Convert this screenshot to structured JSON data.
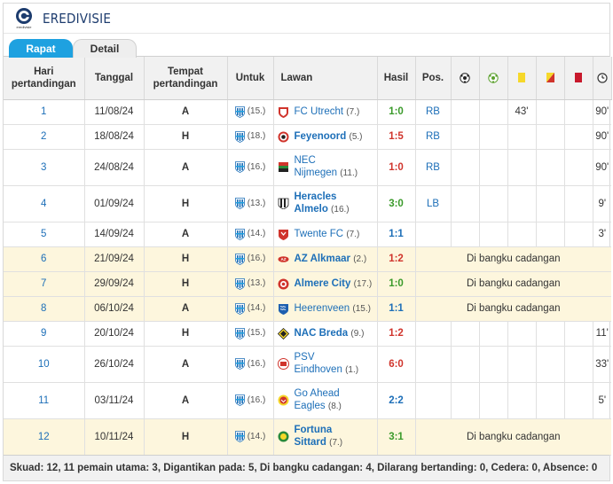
{
  "competition": {
    "name": "EREDIVISIE",
    "logo_text": "eredivisie"
  },
  "tabs": [
    {
      "label": "Rapat"
    },
    {
      "label": "Detail"
    }
  ],
  "headers": {
    "matchday": "Hari pertandingan",
    "date": "Tanggal",
    "venue": "Tempat pertandingan",
    "club": "Untuk",
    "opponent": "Lawan",
    "result": "Hasil",
    "position": "Pos."
  },
  "header_icons": [
    "goals-icon",
    "assists-icon",
    "yellow-card-icon",
    "second-yellow-icon",
    "red-card-icon",
    "minutes-played-icon"
  ],
  "colors": {
    "accent": "#1ea1e0",
    "link": "#1d6fb8",
    "win": "#3a9a2a",
    "loss": "#d0342c",
    "draw": "#1d6fb8",
    "bench_row": "#fdf6dd"
  },
  "rows": [
    {
      "md": "1",
      "date": "11/08/24",
      "venue": "A",
      "club_rank": "(15.)",
      "opponent": "FC Utrecht",
      "opp_rank": "(7.)",
      "opp_bold": false,
      "opp_logo": "fc-utrecht",
      "score": "1:0",
      "outcome": "win",
      "pos": "RB",
      "goals": "",
      "assists": "",
      "yellow": "43'",
      "second_yellow": "",
      "red": "",
      "minutes": "90'",
      "bench": false
    },
    {
      "md": "2",
      "date": "18/08/24",
      "venue": "H",
      "club_rank": "(18.)",
      "opponent": "Feyenoord",
      "opp_rank": "(5.)",
      "opp_bold": true,
      "opp_logo": "feyenoord",
      "score": "1:5",
      "outcome": "loss",
      "pos": "RB",
      "goals": "",
      "assists": "",
      "yellow": "",
      "second_yellow": "",
      "red": "",
      "minutes": "90'",
      "bench": false
    },
    {
      "md": "3",
      "date": "24/08/24",
      "venue": "A",
      "club_rank": "(16.)",
      "opponent": "NEC Nijmegen",
      "opp_rank": "(11.)",
      "opp_bold": false,
      "opp_logo": "nec",
      "score": "1:0",
      "outcome": "loss",
      "pos": "RB",
      "goals": "",
      "assists": "",
      "yellow": "",
      "second_yellow": "",
      "red": "",
      "minutes": "90'",
      "bench": false
    },
    {
      "md": "4",
      "date": "01/09/24",
      "venue": "H",
      "club_rank": "(13.)",
      "opponent": "Heracles Almelo",
      "opp_rank": "(16.)",
      "opp_bold": true,
      "opp_logo": "heracles",
      "score": "3:0",
      "outcome": "win",
      "pos": "LB",
      "goals": "",
      "assists": "",
      "yellow": "",
      "second_yellow": "",
      "red": "",
      "minutes": "9'",
      "bench": false
    },
    {
      "md": "5",
      "date": "14/09/24",
      "venue": "A",
      "club_rank": "(14.)",
      "opponent": "Twente FC",
      "opp_rank": "(7.)",
      "opp_bold": false,
      "opp_logo": "twente",
      "score": "1:1",
      "outcome": "draw",
      "pos": "",
      "goals": "",
      "assists": "",
      "yellow": "",
      "second_yellow": "",
      "red": "",
      "minutes": "3'",
      "bench": false
    },
    {
      "md": "6",
      "date": "21/09/24",
      "venue": "H",
      "club_rank": "(16.)",
      "opponent": "AZ Alkmaar",
      "opp_rank": "(2.)",
      "opp_bold": true,
      "opp_logo": "az",
      "score": "1:2",
      "outcome": "loss",
      "bench": true,
      "bench_text": "Di bangku cadangan"
    },
    {
      "md": "7",
      "date": "29/09/24",
      "venue": "H",
      "club_rank": "(13.)",
      "opponent": "Almere City",
      "opp_rank": "(17.)",
      "opp_bold": true,
      "opp_logo": "almere",
      "score": "1:0",
      "outcome": "win",
      "bench": true,
      "bench_text": "Di bangku cadangan"
    },
    {
      "md": "8",
      "date": "06/10/24",
      "venue": "A",
      "club_rank": "(14.)",
      "opponent": "Heerenveen",
      "opp_rank": "(15.)",
      "opp_bold": false,
      "opp_logo": "heerenveen",
      "score": "1:1",
      "outcome": "draw",
      "bench": true,
      "bench_text": "Di bangku cadangan"
    },
    {
      "md": "9",
      "date": "20/10/24",
      "venue": "H",
      "club_rank": "(15.)",
      "opponent": "NAC Breda",
      "opp_rank": "(9.)",
      "opp_bold": true,
      "opp_logo": "nac",
      "score": "1:2",
      "outcome": "loss",
      "pos": "",
      "goals": "",
      "assists": "",
      "yellow": "",
      "second_yellow": "",
      "red": "",
      "minutes": "11'",
      "bench": false
    },
    {
      "md": "10",
      "date": "26/10/24",
      "venue": "A",
      "club_rank": "(16.)",
      "opponent": "PSV Eindhoven",
      "opp_rank": "(1.)",
      "opp_bold": false,
      "opp_logo": "psv",
      "score": "6:0",
      "outcome": "loss",
      "pos": "",
      "goals": "",
      "assists": "",
      "yellow": "",
      "second_yellow": "",
      "red": "",
      "minutes": "33'",
      "bench": false
    },
    {
      "md": "11",
      "date": "03/11/24",
      "venue": "A",
      "club_rank": "(16.)",
      "opponent": "Go Ahead Eagles",
      "opp_rank": "(8.)",
      "opp_bold": false,
      "opp_logo": "gae",
      "score": "2:2",
      "outcome": "draw",
      "pos": "",
      "goals": "",
      "assists": "",
      "yellow": "",
      "second_yellow": "",
      "red": "",
      "minutes": "5'",
      "bench": false
    },
    {
      "md": "12",
      "date": "10/11/24",
      "venue": "H",
      "club_rank": "(14.)",
      "opponent": "Fortuna Sittard",
      "opp_rank": "(7.)",
      "opp_bold": true,
      "opp_logo": "fortuna",
      "score": "3:1",
      "outcome": "win",
      "bench": true,
      "bench_text": "Di bangku cadangan"
    }
  ],
  "footer": {
    "text": "Skuad: 12, 11 pemain utama: 3, Digantikan pada: 5, Di bangku cadangan: 4, Dilarang bertanding: 0, Cedera: 0, Absence: 0"
  }
}
